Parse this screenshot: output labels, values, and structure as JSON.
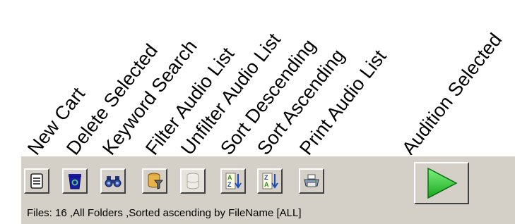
{
  "callouts": {
    "new_cart": "New Cart",
    "delete_selected": "Delete Selected",
    "keyword_search": "Keyword Search",
    "filter_audio_list": "Filter Audio List",
    "unfilter_audio_list": "Unfilter Audio List",
    "sort_descending": "Sort Descending",
    "sort_ascending": "Sort Ascending",
    "print_audio_list": "Print Audio List",
    "audition_selected": "Audition Selected"
  },
  "toolbar": {
    "buttons": [
      {
        "id": "new_cart",
        "icon": "new-cart-icon"
      },
      {
        "id": "delete_selected",
        "icon": "recycle-bin-icon"
      },
      {
        "id": "keyword_search",
        "icon": "binoculars-icon"
      },
      {
        "id": "filter_audio_list",
        "icon": "filter-database-icon"
      },
      {
        "id": "unfilter_audio_list",
        "icon": "database-icon",
        "disabled": true
      },
      {
        "id": "sort_descending",
        "icon": "sort-az-icon"
      },
      {
        "id": "sort_ascending",
        "icon": "sort-za-icon"
      },
      {
        "id": "print_audio_list",
        "icon": "printer-icon"
      },
      {
        "id": "audition_selected",
        "icon": "play-icon"
      }
    ],
    "colors": {
      "face": "#d4d0c8",
      "play_green": "#22c12a",
      "recycle_blue": "#1a1aa8"
    }
  },
  "status": {
    "text": "Files: 16 ,All Folders ,Sorted ascending by FileName [ALL]"
  }
}
